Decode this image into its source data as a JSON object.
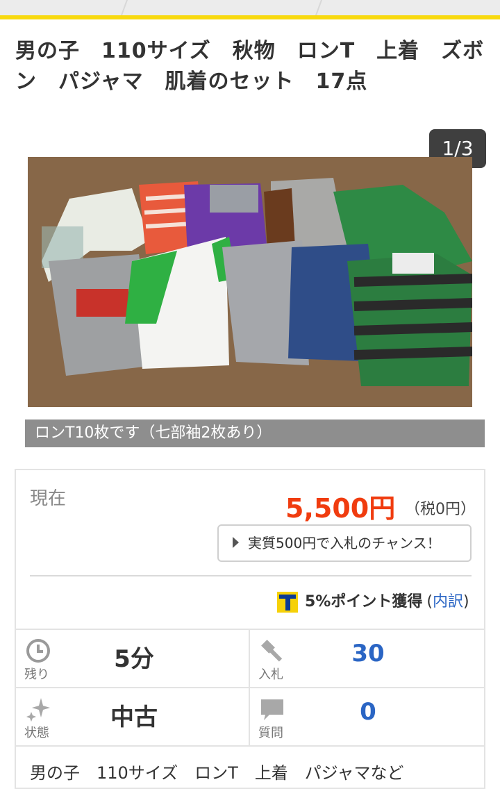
{
  "title": "男の子　110サイズ　秋物　ロンT　上着　ズボン　パジャマ　肌着のセット　17点",
  "gallery": {
    "counter": "1/3",
    "caption": "ロンT10枚です（七部袖2枚あり）"
  },
  "price": {
    "label": "現在",
    "amount": "5,500円",
    "tax": "（税0円）",
    "chance_button": "実質500円で入札のチャンス！",
    "points_text": "5%ポイント獲得",
    "points_open": "(",
    "points_link": "内訳",
    "points_close": ")"
  },
  "stats": {
    "remaining": {
      "label": "残り",
      "value": "5分"
    },
    "bids": {
      "label": "入札",
      "value": "30"
    },
    "condition": {
      "label": "状態",
      "value": "中古"
    },
    "questions": {
      "label": "質問",
      "value": "0"
    }
  },
  "description": "男の子　110サイズ　ロンT　上着　パジャマなど",
  "colors": {
    "accent": "#f8d90f",
    "price": "#f03c0f",
    "link": "#2a65c4"
  },
  "icons": [
    "clock-icon",
    "gavel-icon",
    "sparkle-icon",
    "speech-bubble-icon",
    "t-point-logo"
  ]
}
